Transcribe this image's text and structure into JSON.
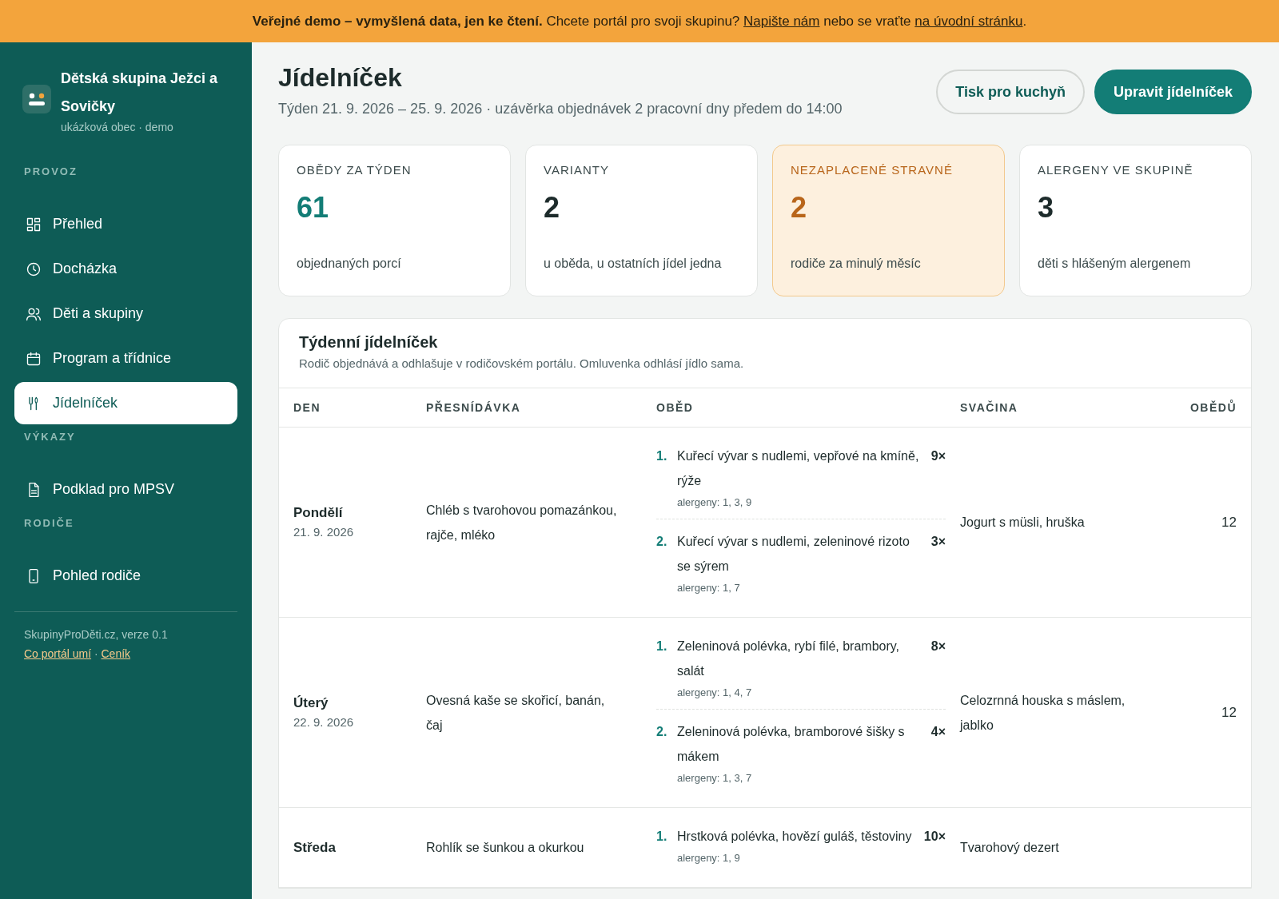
{
  "banner": [
    {
      "kind": "text",
      "text": "**Veřejné demo – vymyšlená data, jen ke čtení.** Chcete portál pro svoji skupinu? "
    },
    {
      "kind": "link",
      "text": "Napište nám"
    },
    {
      "kind": "text",
      "text": " nebo se vraťte "
    },
    {
      "kind": "link",
      "text": "na úvodní stránku"
    },
    {
      "kind": "text",
      "text": "."
    }
  ],
  "sidebar": {
    "org_name": "Dětská skupina Ježci a Sovičky",
    "org_subtitle": "ukázková obec · demo",
    "sections": [
      {
        "title": "PROVOZ",
        "items": [
          {
            "label": "Přehled",
            "selected": false
          },
          {
            "label": "Docházka",
            "selected": false
          },
          {
            "label": "Děti a skupiny",
            "selected": false
          },
          {
            "label": "Program a třídnice",
            "selected": false
          },
          {
            "label": "Jídelníček",
            "selected": true
          }
        ]
      },
      {
        "title": "VÝKAZY",
        "items": [
          {
            "label": "Podklad pro MPSV",
            "selected": false
          }
        ]
      },
      {
        "title": "RODIČE",
        "items": [
          {
            "label": "Pohled rodiče",
            "selected": false
          }
        ]
      }
    ],
    "footer": {
      "version": "SkupinyProDěti.cz, verze 0.1",
      "links": [
        "Co portál umí",
        "Ceník"
      ],
      "separator": "·"
    }
  },
  "page": {
    "title": "Jídelníček",
    "subtitle": "Týden 21. 9. 2026 – 25. 9. 2026 · uzávěrka objednávek 2 pracovní dny předem do 14:00",
    "buttons": [
      {
        "label": "Tisk pro kuchyň",
        "kind": "secondary"
      },
      {
        "label": "Upravit jídelníček",
        "kind": "primary"
      }
    ]
  },
  "stats": [
    {
      "label": "OBĚDY ZA TÝDEN",
      "value": "61",
      "caption": "objednaných porcí",
      "kind": "accent"
    },
    {
      "label": "VARIANTY",
      "value": "2",
      "caption": "u oběda, u ostatních jídel jedna",
      "kind": "plain"
    },
    {
      "label": "NEZAPLACENÉ STRAVNÉ",
      "value": "2",
      "caption": "rodiče za minulý měsíc",
      "kind": "warning"
    },
    {
      "label": "ALERGENY VE SKUPINĚ",
      "value": "3",
      "caption": "děti s hlášeným alergenem",
      "kind": "plain"
    }
  ],
  "menu": {
    "title": "Týdenní jídelníček",
    "description": "Rodič objednává a odhlašuje v rodičovském portálu. Omluvenka odhlásí jídlo sama.",
    "columns": [
      "DEN",
      "PŘESNÍDÁVKA",
      "OBĚD",
      "SVAČINA",
      "OBĚDŮ"
    ],
    "rows": [
      {
        "day": "Pondělí",
        "date": "21. 9. 2026",
        "breakfast": "Chléb s tvarohovou pomazánkou, rajče, mléko",
        "lunch": [
          {
            "number": "1.",
            "dish": "Kuřecí vývar s nudlemi, vepřové na kmíně, rýže",
            "count": "9×",
            "allergens": "alergeny: 1, 3, 9"
          },
          {
            "number": "2.",
            "dish": "Kuřecí vývar s nudlemi, zeleninové rizoto se sýrem",
            "count": "3×",
            "allergens": "alergeny: 1, 7"
          }
        ],
        "snack": "Jogurt s müsli, hruška",
        "total": "12"
      },
      {
        "day": "Úterý",
        "date": "22. 9. 2026",
        "breakfast": "Ovesná kaše se skořicí, banán, čaj",
        "lunch": [
          {
            "number": "1.",
            "dish": "Zeleninová polévka, rybí filé, brambory, salát",
            "count": "8×",
            "allergens": "alergeny: 1, 4, 7"
          },
          {
            "number": "2.",
            "dish": "Zeleninová polévka, bramborové šišky s mákem",
            "count": "4×",
            "allergens": "alergeny: 1, 3, 7"
          }
        ],
        "snack": "Celozrnná houska s máslem, jablko",
        "total": "12"
      },
      {
        "day": "Středa",
        "breakfast": "Rohlík se šunkou a okurkou",
        "lunch": [
          {
            "number": "1.",
            "dish": "Hrstková polévka, hovězí guláš, těstoviny",
            "count": "10×",
            "allergens": "alergeny: 1, 9"
          }
        ],
        "snack": "Tvarohový dezert"
      }
    ]
  }
}
